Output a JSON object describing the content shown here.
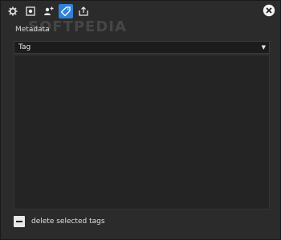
{
  "toolbar": {
    "buttons": [
      {
        "icon": "gear-icon",
        "active": false
      },
      {
        "icon": "badge-icon",
        "active": false
      },
      {
        "icon": "add-person-icon",
        "active": false
      },
      {
        "icon": "tag-icon",
        "active": true
      },
      {
        "icon": "export-icon",
        "active": false
      }
    ]
  },
  "watermark": "SOFTPEDIA",
  "metadata": {
    "label": "Metadata",
    "selected": "Tag"
  },
  "footer": {
    "delete_label": "delete selected tags"
  },
  "colors": {
    "background": "#2b2b2b",
    "accent": "#2f82d8"
  }
}
